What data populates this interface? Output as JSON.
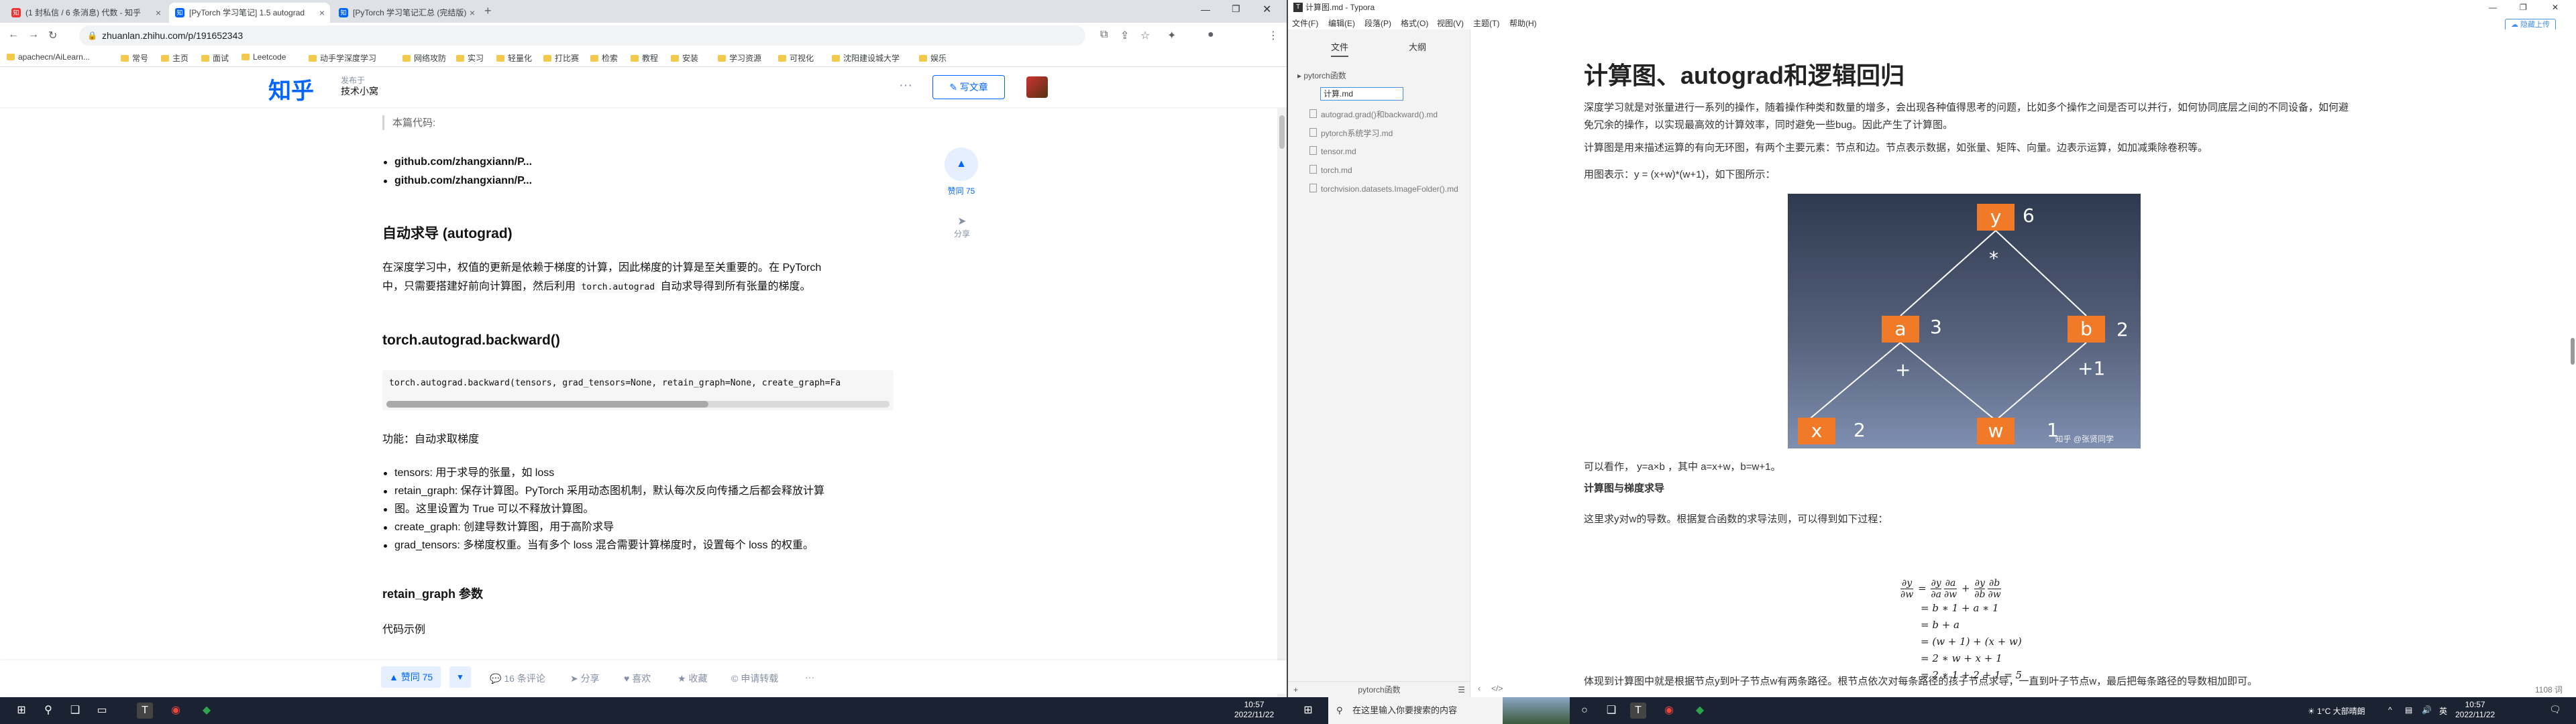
{
  "chrome": {
    "tabs": [
      {
        "label": "(1 封私信 / 6 条消息) 代数 - 知乎",
        "icon": "zhihu-icon"
      },
      {
        "label": "[PyTorch 学习笔记] 1.5 autograd",
        "icon": "zhihu-icon"
      },
      {
        "label": "[PyTorch 学习笔记汇总 (完结版)",
        "icon": "zhihu-icon"
      }
    ],
    "new_tab": "+",
    "url": "zhuanlan.zhihu.com/p/191652343",
    "bookmarks": [
      "apachecn/AiLearn...",
      "常号",
      "主页",
      "面试",
      "Leetcode",
      "动手学深度学习",
      "网络攻防",
      "实习",
      "轻量化",
      "打比赛",
      "检索",
      "教程",
      "安装",
      "学习资源",
      "可视化",
      "沈阳建设城大学",
      "娱乐"
    ]
  },
  "zhihu": {
    "logo": "知乎",
    "sub_label": "发布于",
    "column": "技术小窝",
    "more": "···",
    "write": "写文章",
    "quote": "本篇代码:",
    "links": [
      "github.com/zhangxiann/P...",
      "github.com/zhangxiann/P..."
    ],
    "h_autograd": "自动求导 (autograd)",
    "para1_a": "在深度学习中，权值的更新是依赖于梯度的计算，因此梯度的计算是至关重要的。在 PyTorch",
    "para1_b": "中，只需要搭建好前向计算图，然后利用",
    "para1_code": "torch.autograd",
    "para1_c": "自动求导得到所有张量的梯度。",
    "h_backward": "torch.autograd.backward()",
    "code": "torch.autograd.backward(tensors, grad_tensors=None, retain_graph=None, create_graph=Fa",
    "func_label": "功能：自动求取梯度",
    "params": [
      "tensors: 用于求导的张量，如 loss",
      "retain_graph: 保存计算图。PyTorch 采用动态图机制，默认每次反向传播之后都会释放计算",
      "图。这里设置为 True 可以不释放计算图。",
      "create_graph: 创建导数计算图，用于高阶求导",
      "grad_tensors: 多梯度权重。当有多个 loss 混合需要计算梯度时，设置每个 loss 的权重。"
    ],
    "h_retain": "retain_graph 参数",
    "code_example": "代码示例",
    "side_vote": "赞同 75",
    "side_share": "分享",
    "actions": {
      "vote": "▲ 赞同 75",
      "down": "▼",
      "comments": "16 条评论",
      "share": "分享",
      "like": "喜欢",
      "collect": "收藏",
      "apply": "申请转载",
      "more": "···"
    }
  },
  "typora": {
    "title": "计算图.md - Typora",
    "menu": [
      "文件(F)",
      "编辑(E)",
      "段落(P)",
      "格式(O)",
      "视图(V)",
      "主题(T)",
      "帮助(H)"
    ],
    "upload": "隐藏上传",
    "side_tabs": [
      "文件",
      "大纲"
    ],
    "folder": "pytorch函数",
    "rename_value": "计算.md",
    "files": [
      "autograd.grad()和backward().md",
      "pytorch系统学习.md",
      "tensor.md",
      "torch.md",
      "torchvision.datasets.ImageFolder().md"
    ],
    "side_footer": "pytorch函数",
    "doc": {
      "h1": "计算图、autograd和逻辑回归",
      "p1": "深度学习就是对张量进行一系列的操作，随着操作种类和数量的增多，会出现各种值得思考的问题，比如多个操作之间是否可以并行，如何协同底层之间的不同设备，如何避免冗余的操作，以实现最高效的计算效率，同时避免一些bug。因此产生了计算图。",
      "p2": "计算图是用来描述运算的有向无环图，有两个主要元素：节点和边。节点表示数据，如张量、矩阵、向量。边表示运算，如加减乘除卷积等。",
      "p3": "用图表示：y = (x+w)*(w+1)，如下图所示：",
      "graph": {
        "nodes": [
          {
            "name": "y",
            "value": "6"
          },
          {
            "name": "a",
            "value": "3"
          },
          {
            "name": "b",
            "value": "2"
          },
          {
            "name": "x",
            "value": "2"
          },
          {
            "name": "w",
            "value": "1"
          }
        ],
        "ops": [
          "*",
          "+",
          "+1"
        ],
        "watermark": "知乎 @张贤同学"
      },
      "p4": "可以看作， y=a×b ，其中 a=x+w，b=w+1。",
      "h_grad": "计算图与梯度求导",
      "p5": "这里求y对w的导数。根据复合函数的求导法则，可以得到如下过程：",
      "p6": "体现到计算图中就是根据节点y到叶子节点w有两条路径。根节点依次对每条路径的孩子节点求导，一直到叶子节点w，最后把每条路径的导数相加即可。"
    },
    "word_count": "1108 词"
  },
  "taskbar_left": {
    "search_text": "",
    "time": "10:57",
    "date": "2022/11/22"
  },
  "taskbar_right": {
    "search_text": "在这里输入你要搜索的内容",
    "weather": "1°C 大部晴朗",
    "ime": "英",
    "time": "10:57",
    "date": "2022/11/22"
  }
}
